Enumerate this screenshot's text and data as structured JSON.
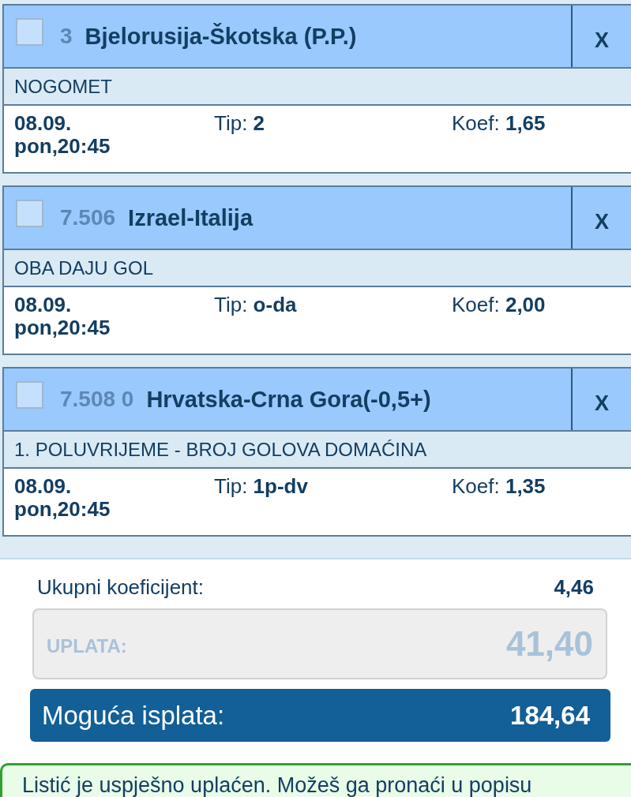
{
  "bets": [
    {
      "checked": false,
      "code": "3",
      "title": "Bjelorusija-Škotska (P.P.)",
      "remove": "X",
      "market": "NOGOMET",
      "date": "08.09. pon,20:45",
      "tip": "Tip: **2**",
      "odds": "Koef: **1,65**"
    },
    {
      "checked": false,
      "code": "7.506",
      "title": "Izrael-Italija",
      "remove": "X",
      "market": "OBA DAJU GOL",
      "date": "08.09. pon,20:45",
      "tip": "Tip: **o-da**",
      "odds": "Koef: **2,00**"
    },
    {
      "checked": false,
      "code": "7.508 0",
      "title": "Hrvatska-Crna Gora(-0,5+)",
      "remove": "X",
      "market": "1. POLUVRIJEME - BROJ GOLOVA DOMAĆINA",
      "date": "08.09. pon,20:45",
      "tip": "Tip: **1p-dv**",
      "odds": "Koef: **1,35**"
    }
  ],
  "summary": {
    "label": "Ukupni koeficijent:",
    "value": "4,46"
  },
  "stake": {
    "label": "UPLATA:",
    "value": "41,40",
    "disabled": true
  },
  "payout": {
    "label": "Moguća isplata:",
    "value": "184,64"
  },
  "message": {
    "text": "Listić je uspješno uplaćen. Možeš ga pronaći u popisu"
  }
}
